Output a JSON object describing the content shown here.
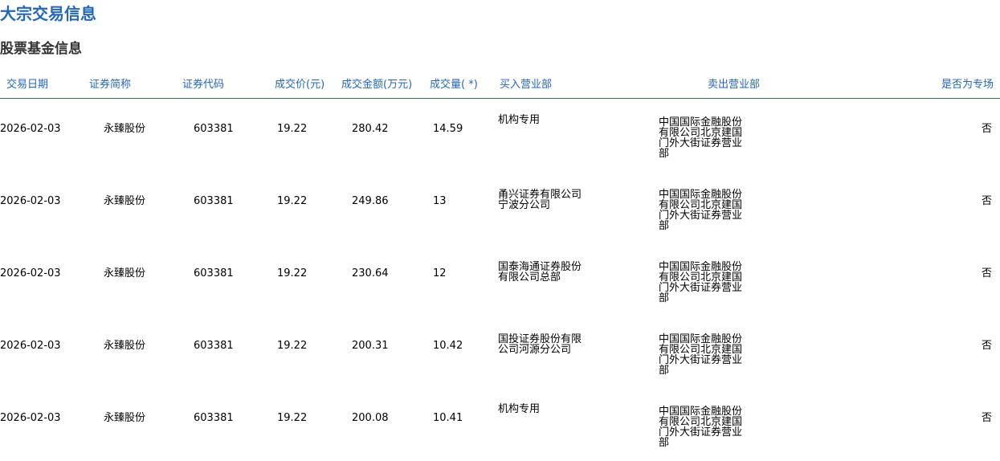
{
  "page": {
    "title": "大宗交易信息",
    "section_title": "股票基金信息"
  },
  "table": {
    "headers": {
      "date": "交易日期",
      "name": "证券简称",
      "code": "证券代码",
      "price": "成交价(元)",
      "amount": "成交金额(万元)",
      "volume": "成交量( *)",
      "buyer": "买入营业部",
      "seller": "卖出营业部",
      "special": "是否为专场"
    },
    "rows": [
      {
        "date": "2026-02-03",
        "name": "永臻股份",
        "code": "603381",
        "price": "19.22",
        "amount": "280.42",
        "volume": "14.59",
        "buyer": "机构专用",
        "seller": "中国国际金融股份有限公司北京建国门外大街证券营业部",
        "special": "否"
      },
      {
        "date": "2026-02-03",
        "name": "永臻股份",
        "code": "603381",
        "price": "19.22",
        "amount": "249.86",
        "volume": "13",
        "buyer": "甬兴证券有限公司宁波分公司",
        "seller": "中国国际金融股份有限公司北京建国门外大街证券营业部",
        "special": "否"
      },
      {
        "date": "2026-02-03",
        "name": "永臻股份",
        "code": "603381",
        "price": "19.22",
        "amount": "230.64",
        "volume": "12",
        "buyer": "国泰海通证券股份有限公司总部",
        "seller": "中国国际金融股份有限公司北京建国门外大街证券营业部",
        "special": "否"
      },
      {
        "date": "2026-02-03",
        "name": "永臻股份",
        "code": "603381",
        "price": "19.22",
        "amount": "200.31",
        "volume": "10.42",
        "buyer": "国投证券股份有限公司河源分公司",
        "seller": "中国国际金融股份有限公司北京建国门外大街证券营业部",
        "special": "否"
      },
      {
        "date": "2026-02-03",
        "name": "永臻股份",
        "code": "603381",
        "price": "19.22",
        "amount": "200.08",
        "volume": "10.41",
        "buyer": "机构专用",
        "seller": "中国国际金融股份有限公司北京建国门外大街证券营业部",
        "special": "否"
      }
    ]
  },
  "colors": {
    "title": "#2366c0",
    "section_title": "#333333",
    "header_text": "#2366c0",
    "header_rule": "#2e7d4f"
  }
}
